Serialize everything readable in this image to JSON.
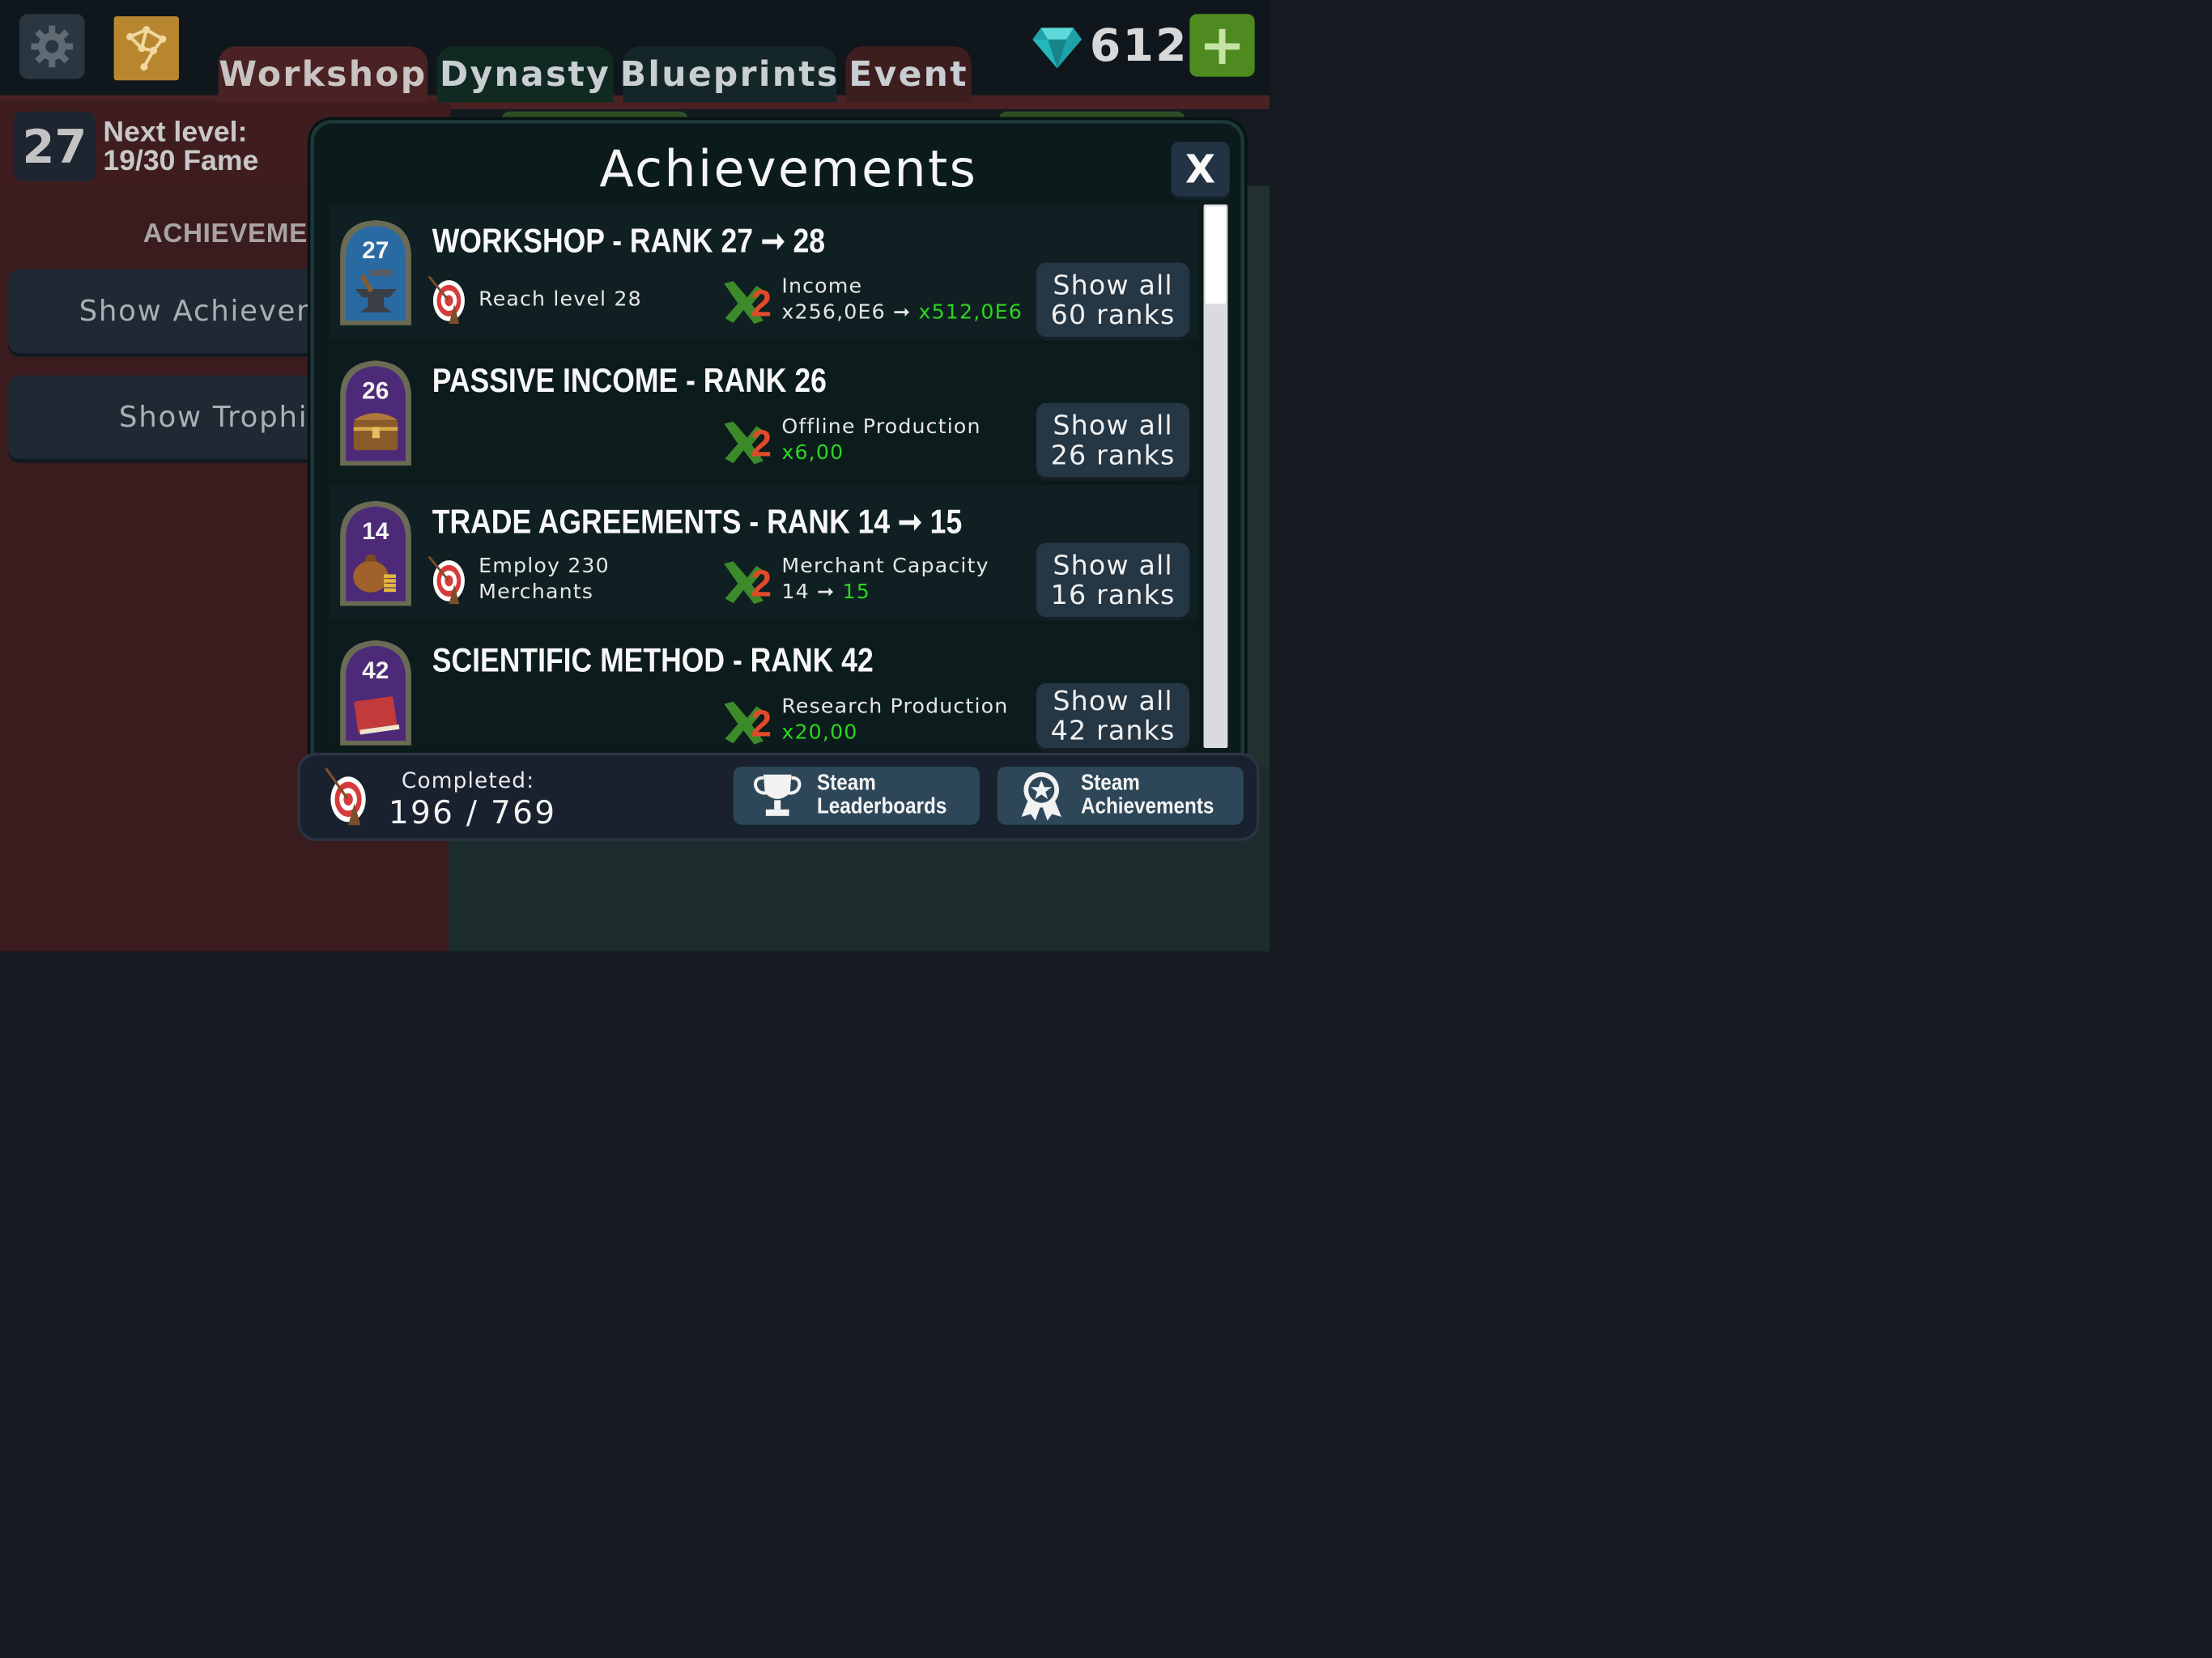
{
  "header": {
    "tabs": [
      {
        "label": "Workshop",
        "active": true
      },
      {
        "label": "Dynasty",
        "active": false
      },
      {
        "label": "Blueprints",
        "active": false
      },
      {
        "label": "Event",
        "active": false
      }
    ],
    "gems": "612",
    "icons": [
      "gear-icon",
      "map-icon",
      "gem-icon",
      "plus-icon"
    ]
  },
  "level": {
    "value": "27",
    "line1": "Next level:",
    "line2": "19/30 Fame"
  },
  "left_panel": {
    "heading": "ACHIEVEMENTS",
    "show_achievements": "Show Achievements",
    "show_trophies": "Show Trophies"
  },
  "modal": {
    "title": "Achievements",
    "close": "X",
    "rows": [
      {
        "badge": "27",
        "badge_icon": "anvil-hammer-icon",
        "badge_color": "#2a6aa3",
        "title": "WORKSHOP - RANK 27",
        "arrow": "➞",
        "next": "28",
        "goal": "Reach level 28",
        "reward_name": "Income",
        "reward_from": "x256,0E6",
        "reward_to": "x512,0E6",
        "show_all_1": "Show all",
        "show_all_2": "60 ranks"
      },
      {
        "badge": "26",
        "badge_icon": "treasure-chest-icon",
        "badge_color": "#4c2a78",
        "title": "PASSIVE INCOME - RANK 26",
        "reward_name": "Offline Production",
        "reward_value": "x6,00",
        "show_all_1": "Show all",
        "show_all_2": "26 ranks"
      },
      {
        "badge": "14",
        "badge_icon": "money-bag-icon",
        "badge_color": "#4c2a78",
        "title": "TRADE AGREEMENTS - RANK 14",
        "arrow": "➞",
        "next": "15",
        "goal_1": "Employ 230",
        "goal_2": "Merchants",
        "reward_name": "Merchant Capacity",
        "reward_from": "14",
        "reward_to": "15",
        "show_all_1": "Show all",
        "show_all_2": "16 ranks"
      },
      {
        "badge": "42",
        "badge_icon": "book-icon",
        "badge_color": "#4c2a78",
        "title": "SCIENTIFIC METHOD - RANK 42",
        "reward_name": "Research Production",
        "reward_value": "x20,00",
        "show_all_1": "Show all",
        "show_all_2": "42 ranks"
      }
    ],
    "arrow_small": "➞"
  },
  "footer": {
    "completed_label": "Completed:",
    "completed_value": "196 / 769",
    "leaderboards_1": "Steam",
    "leaderboards_2": "Leaderboards",
    "achievements_1": "Steam",
    "achievements_2": "Achievements"
  }
}
